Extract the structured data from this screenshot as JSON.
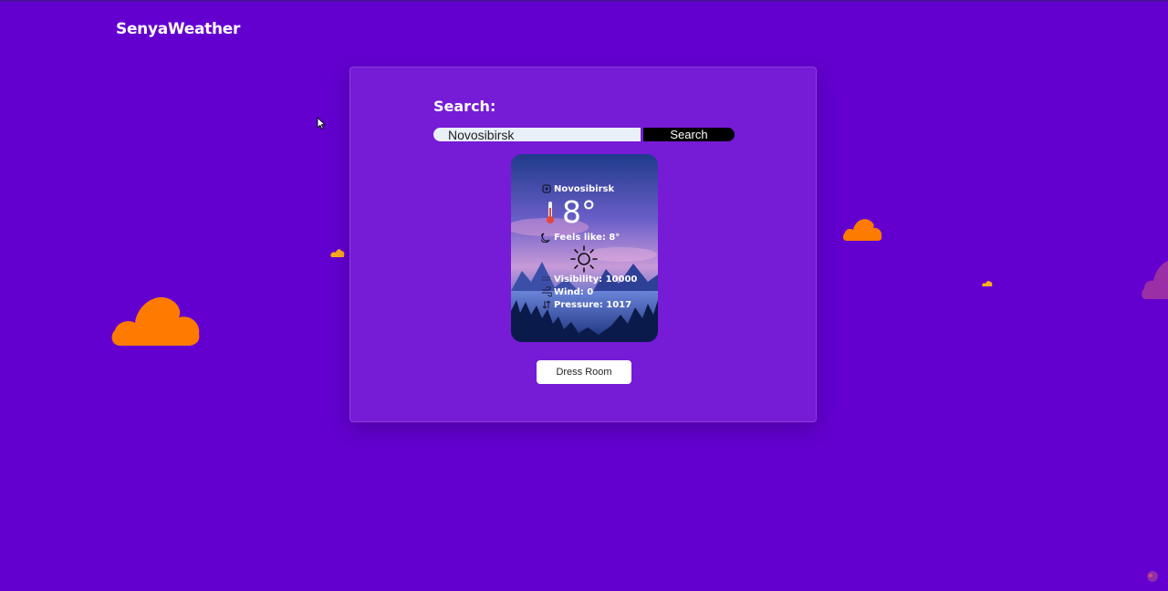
{
  "app": {
    "logo": "SenyaWeather"
  },
  "search": {
    "label": "Search:",
    "input_value": "Novosibirsk",
    "button_label": "Search"
  },
  "weather": {
    "city": "Novosibirsk",
    "temperature": "8°",
    "feels_like": "Feels like: 8°",
    "condition_icon": "sun-icon",
    "visibility": "Visibility: 10000",
    "wind": "Wind: 0",
    "pressure": "Pressure: 1017"
  },
  "actions": {
    "dress_room_label": "Dress Room"
  },
  "colors": {
    "background": "#6300cf",
    "panel": "#761bd6",
    "cloud_large": "#ff7a00",
    "cloud_small": "#ffae1a"
  },
  "icons": [
    "location-icon",
    "thermometer-icon",
    "moon-icon",
    "sun-icon",
    "visibility-icon",
    "wind-icon",
    "pressure-icon",
    "cursor-icon"
  ]
}
